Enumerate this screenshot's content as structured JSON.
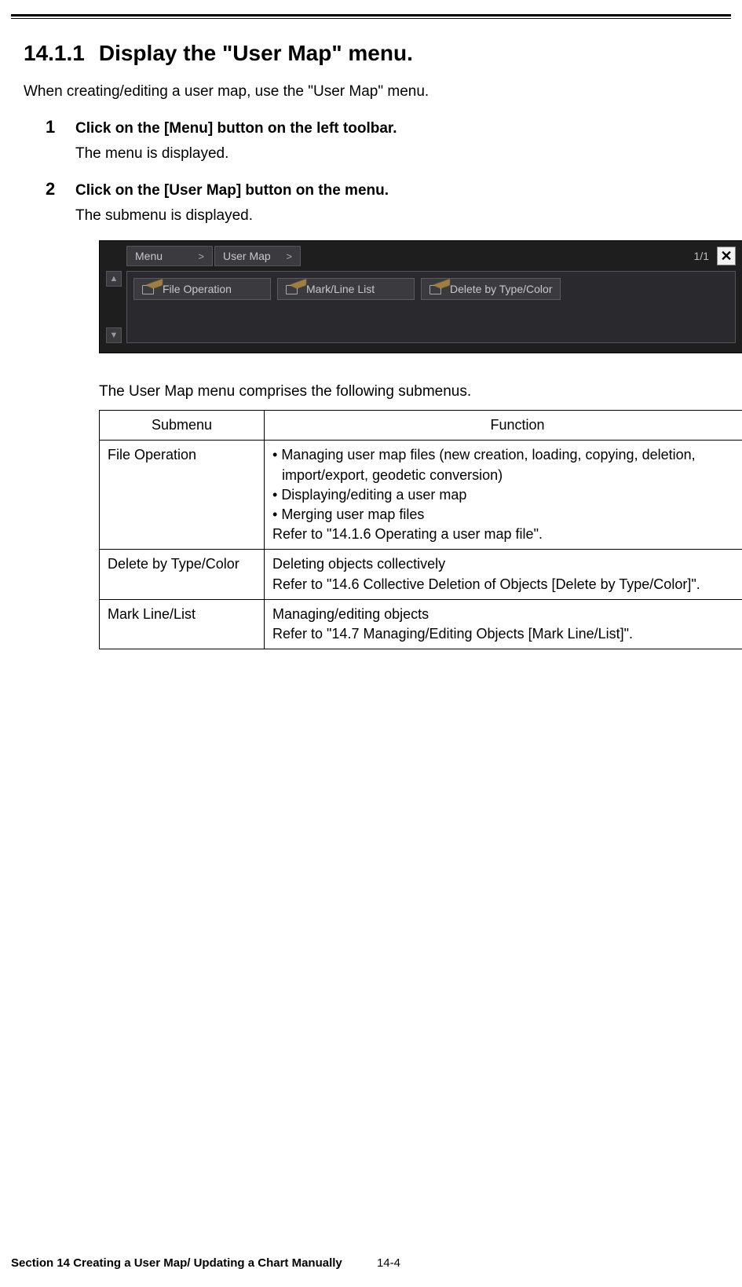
{
  "heading": {
    "number": "14.1.1",
    "title": "Display the \"User Map\" menu."
  },
  "intro": "When creating/editing a user map, use the \"User Map\" menu.",
  "steps": [
    {
      "num": "1",
      "title": "Click on the [Menu] button on the left toolbar.",
      "desc": "The menu is displayed."
    },
    {
      "num": "2",
      "title": "Click on the [User Map] button on the menu.",
      "desc": "The submenu is displayed."
    }
  ],
  "screenshot": {
    "breadcrumb": [
      "Menu",
      "User Map"
    ],
    "page_indicator": "1/1",
    "close_label": "✕",
    "arrows": {
      "up": "▲",
      "down": "▼"
    },
    "menu_buttons": [
      "File Operation",
      "Mark/Line List",
      "Delete by Type/Color"
    ]
  },
  "table_intro": "The User Map menu comprises the following submenus.",
  "table": {
    "headers": [
      "Submenu",
      "Function"
    ],
    "rows": [
      {
        "submenu": "File Operation",
        "function_items": [
          {
            "bullet": true,
            "text": "Managing user map files (new creation, loading, copying, deletion, import/export, geodetic conversion)"
          },
          {
            "bullet": true,
            "text": "Displaying/editing a user map"
          },
          {
            "bullet": true,
            "text": "Merging user map files"
          },
          {
            "bullet": false,
            "text": "Refer to \"14.1.6 Operating a user map file\"."
          }
        ]
      },
      {
        "submenu": "Delete by Type/Color",
        "function_items": [
          {
            "bullet": false,
            "text": "Deleting objects collectively"
          },
          {
            "bullet": false,
            "text": "Refer to \"14.6 Collective Deletion of Objects [Delete by Type/Color]\"."
          }
        ]
      },
      {
        "submenu": "Mark Line/List",
        "function_items": [
          {
            "bullet": false,
            "text": "Managing/editing objects"
          },
          {
            "bullet": false,
            "text": "Refer to \"14.7 Managing/Editing Objects [Mark Line/List]\"."
          }
        ]
      }
    ]
  },
  "footer": {
    "section_title": "Section 14    Creating a User Map/ Updating a Chart Manually",
    "page": "14-4"
  }
}
